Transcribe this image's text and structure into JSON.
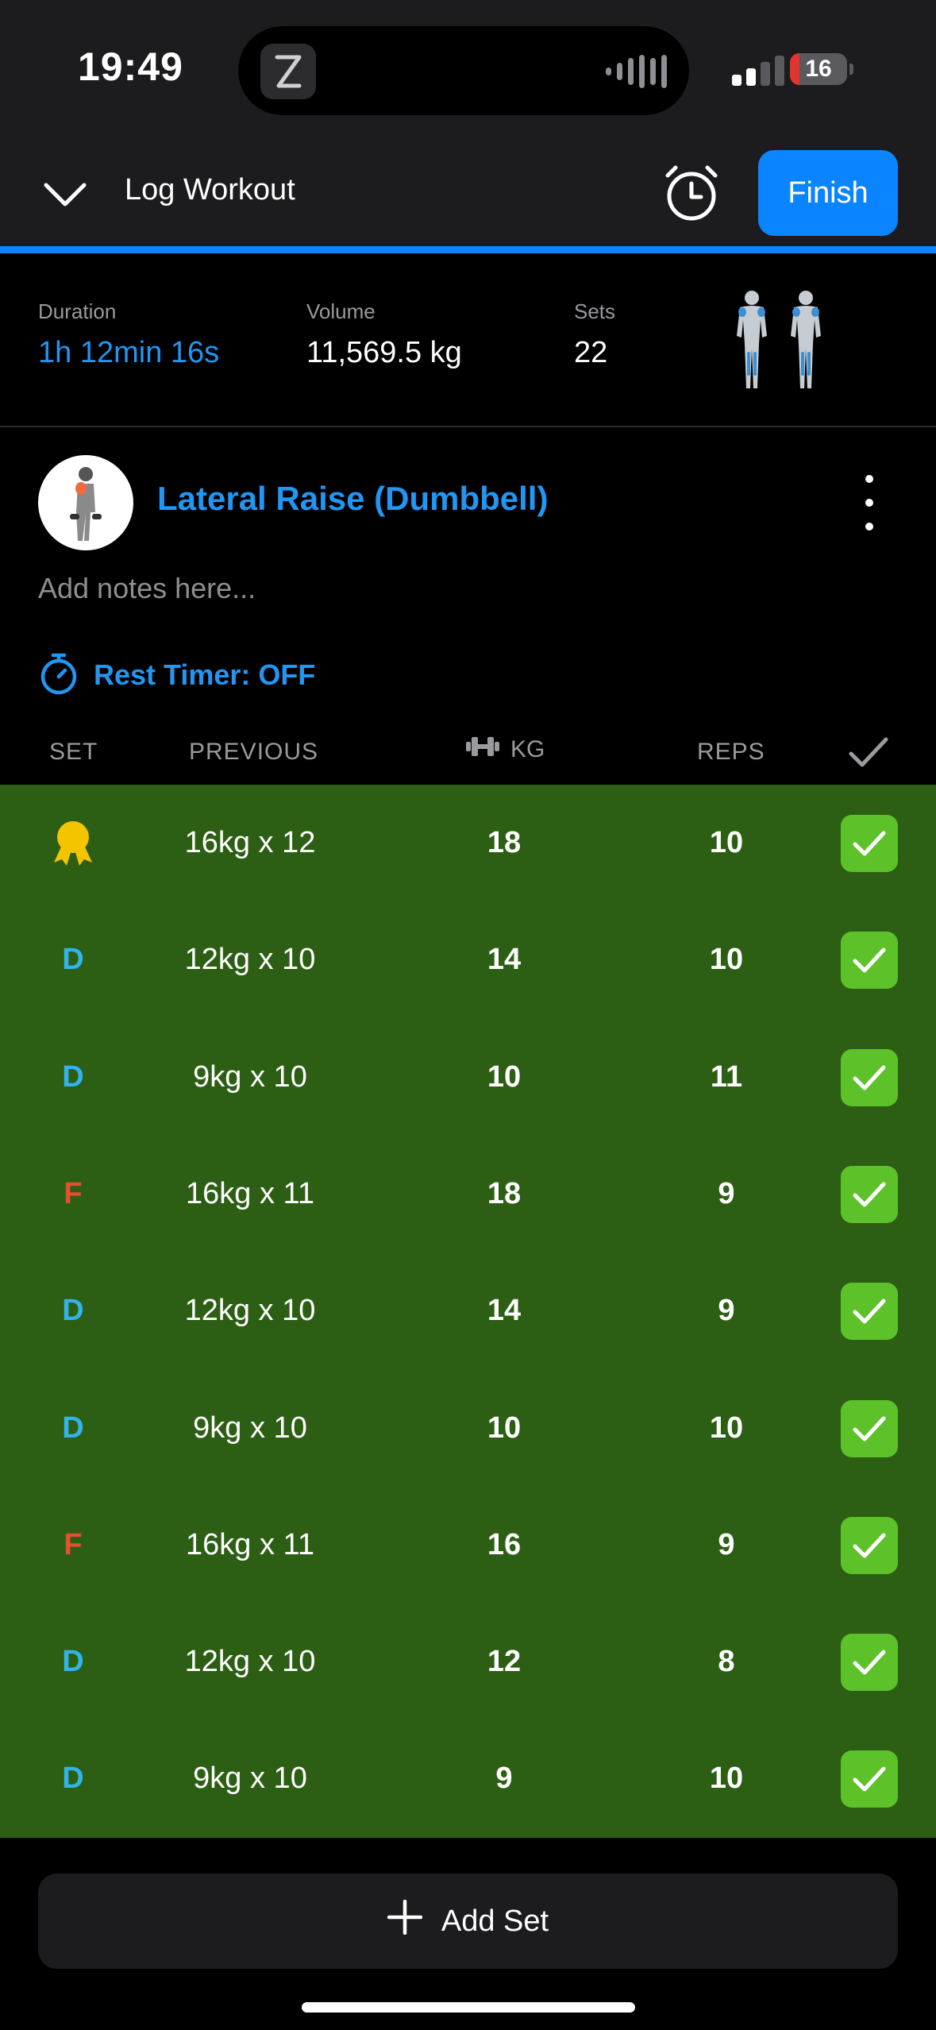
{
  "status": {
    "time": "19:49",
    "battery": "16",
    "battery_level": 0.16
  },
  "header": {
    "title": "Log Workout",
    "finish_label": "Finish"
  },
  "summary": {
    "duration_label": "Duration",
    "duration_value": "1h 12min 16s",
    "volume_label": "Volume",
    "volume_value": "11,569.5 kg",
    "sets_label": "Sets",
    "sets_value": "22"
  },
  "exercise": {
    "name": "Lateral Raise (Dumbbell)",
    "notes_placeholder": "Add notes here...",
    "rest_timer": "Rest Timer: OFF"
  },
  "table": {
    "headers": {
      "set": "SET",
      "previous": "PREVIOUS",
      "kg": "KG",
      "reps": "REPS"
    },
    "rows": [
      {
        "set": "",
        "type": "record",
        "previous": "16kg x 12",
        "kg": "18",
        "reps": "10"
      },
      {
        "set": "D",
        "type": "drop",
        "previous": "12kg x 10",
        "kg": "14",
        "reps": "10"
      },
      {
        "set": "D",
        "type": "drop",
        "previous": "9kg x 10",
        "kg": "10",
        "reps": "11"
      },
      {
        "set": "F",
        "type": "failure",
        "previous": "16kg x 11",
        "kg": "18",
        "reps": "9"
      },
      {
        "set": "D",
        "type": "drop",
        "previous": "12kg x 10",
        "kg": "14",
        "reps": "9"
      },
      {
        "set": "D",
        "type": "drop",
        "previous": "9kg x 10",
        "kg": "10",
        "reps": "10"
      },
      {
        "set": "F",
        "type": "failure",
        "previous": "16kg x 11",
        "kg": "16",
        "reps": "9"
      },
      {
        "set": "D",
        "type": "drop",
        "previous": "12kg x 10",
        "kg": "12",
        "reps": "8"
      },
      {
        "set": "D",
        "type": "drop",
        "previous": "9kg x 10",
        "kg": "9",
        "reps": "10"
      }
    ]
  },
  "add_set_label": "Add Set",
  "colors": {
    "accent": "#0a84ff",
    "link_blue": "#2196f3",
    "row_bg": "#2c5f14",
    "check_green": "#5dc22a",
    "drop_set": "#32b4ea",
    "failure_set": "#e4502f",
    "medal": "#f5c400"
  },
  "icons": {
    "collapse": "chevron-down-icon",
    "timer": "alarm-clock-icon",
    "rest": "stopwatch-icon",
    "more": "kebab-menu-icon",
    "weight": "dumbbell-icon",
    "done": "checkmark-icon",
    "record": "medal-icon",
    "add": "plus-icon"
  }
}
